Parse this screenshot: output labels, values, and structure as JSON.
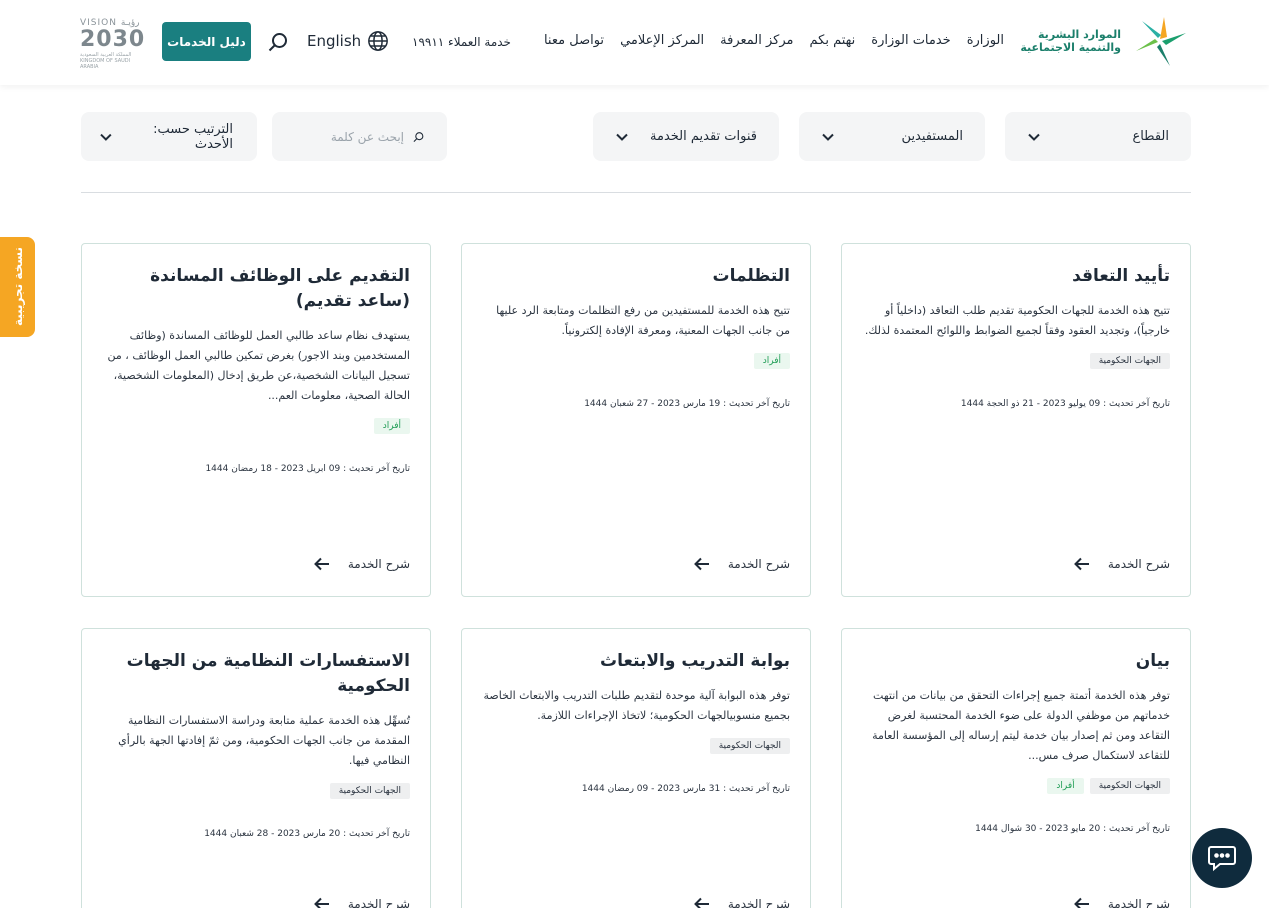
{
  "header": {
    "logo": {
      "line1": "الموارد البشرية",
      "line2": "والتنمية الاجتماعية"
    },
    "nav": [
      "الوزارة",
      "خدمات الوزارة",
      "نهتم بكم",
      "مركز المعرفة",
      "المركز الإعلامي",
      "تواصل معنا"
    ],
    "customer_service": "خدمة العملاء ١٩٩١١",
    "language": "English",
    "guide_button": "دليل الخدمات",
    "vision": {
      "top": "VISION رؤيـة",
      "number": "2030",
      "sub1": "المملكة العربية السعودية",
      "sub2": "KINGDOM OF SAUDI ARABIA"
    }
  },
  "filters": {
    "sector": "القطاع",
    "beneficiaries": "المستفيدين",
    "channels": "قنوات تقديم الخدمة",
    "search_placeholder": "إبحث عن كلمة",
    "sort": "الترتيب حسب: الأحدث"
  },
  "side_tab": "نسخة تجريبية",
  "cards": [
    {
      "title": "تأييد التعاقد",
      "description": "تتيح هذه الخدمة للجهات الحكومية تقديم طلب التعاقد (داخلياً أو خارجياً)، وتجديد العقود وفقاً لجميع الضوابط واللوائح المعتمدة لذلك.",
      "tags": [
        "الجهات الحكومية"
      ],
      "date": "تاريخ آخر تحديث : 09 يوليو 2023 - 21 ذو الحجة 1444",
      "link": "شرح الخدمة"
    },
    {
      "title": "التظلمات",
      "description": "تتيح هذه الخدمة للمستفيدين من رفع التظلمات ومتابعة الرد عليها من جانب الجهات المعنية، ومعرفة الإفادة إلكترونياً.",
      "tags": [
        "أفراد"
      ],
      "date": "تاريخ آخر تحديث : 19 مارس 2023 - 27 شعبان 1444",
      "link": "شرح الخدمة"
    },
    {
      "title": "التقديم على الوظائف المساندة (ساعد تقديم)",
      "description": "يستهدف نظام ساعد طالبي العمل للوظائف المساندة (وظائف المستخدمين وبند الاجور) بغرض تمكين طالبي العمل الوظائف ، من تسجيل البيانات الشخصية،عن طريق إدخال (المعلومات الشخصية، الحالة الصحية، معلومات العم...",
      "tags": [
        "أفراد"
      ],
      "date": "تاريخ آخر تحديث : 09 ابريل 2023 - 18 رمضان 1444",
      "link": "شرح الخدمة"
    },
    {
      "title": "بيان",
      "description": "توفر هذه الخدمة أتمتة جميع إجراءات التحقق من بيانات من انتهت خدماتهم من موظفي الدولة على ضوء الخدمة المحتسبة لغرض التقاعد ومن ثم إصدار بيان خدمة ليتم إرساله إلى المؤسسة العامة للتقاعد لاستكمال صرف مس...",
      "tags": [
        "الجهات الحكومية",
        "أفراد"
      ],
      "date": "تاريخ آخر تحديث : 20 مايو 2023 - 30 شوال 1444",
      "link": "شرح الخدمة"
    },
    {
      "title": "بوابة التدريب والابتعاث",
      "description": "توفر هذه البوابة آلية موحدة لتقديم طلبات التدريب والابتعاث الخاصة بجميع منسوبيالجهات الحكومية؛ لاتخاذ الإجراءات اللازمة.",
      "tags": [
        "الجهات الحكومية"
      ],
      "date": "تاريخ آخر تحديث : 31 مارس 2023 - 09 رمضان 1444",
      "link": "شرح الخدمة"
    },
    {
      "title": "الاستفسارات النظامية من الجهات الحكومية",
      "description": "تُسهِّل هذه الخدمة عملية متابعة ودراسة الاستفسارات النظامية المقدمة من جانب الجهات الحكومية، ومن ثمّ إفادتها الجهة بالرأي النظامي فيها.",
      "tags": [
        "الجهات الحكومية"
      ],
      "date": "تاريخ آخر تحديث : 20 مارس 2023 - 28 شعبان 1444",
      "link": "شرح الخدمة"
    }
  ],
  "colors": {
    "primary": "#1a7f80",
    "accent": "#f5a623",
    "chat": "#0f2b3d"
  }
}
